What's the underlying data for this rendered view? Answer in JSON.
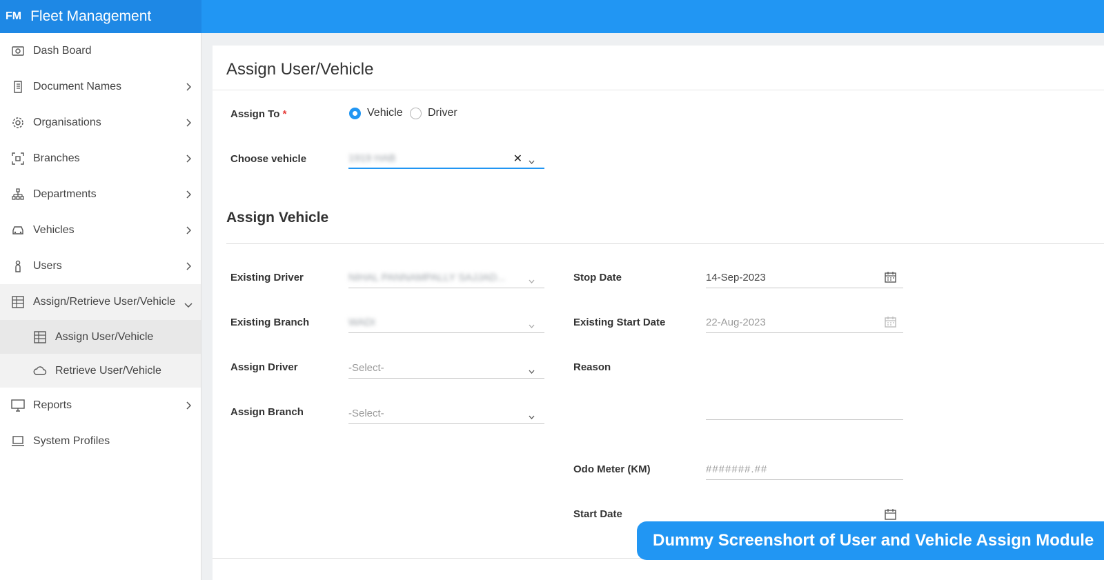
{
  "brand": {
    "abbr": "FM",
    "name": "Fleet Management"
  },
  "sidebar": {
    "items": [
      {
        "label": "Dash Board"
      },
      {
        "label": "Document Names"
      },
      {
        "label": "Organisations"
      },
      {
        "label": "Branches"
      },
      {
        "label": "Departments"
      },
      {
        "label": "Vehicles"
      },
      {
        "label": "Users"
      },
      {
        "label": "Assign/Retrieve User/Vehicle"
      },
      {
        "label": "Reports"
      },
      {
        "label": "System Profiles"
      }
    ],
    "sub_items": [
      {
        "label": "Assign User/Vehicle"
      },
      {
        "label": "Retrieve User/Vehicle"
      }
    ]
  },
  "page": {
    "title": "Assign User/Vehicle",
    "assign_to_label": "Assign To",
    "required_mark": "*",
    "radio_vehicle": "Vehicle",
    "radio_driver": "Driver",
    "choose_vehicle_label": "Choose vehicle",
    "choose_vehicle_value": "1919 HAB",
    "section_title": "Assign Vehicle"
  },
  "form": {
    "existing_driver_label": "Existing Driver",
    "existing_driver_value": "NIHAL PANNAMPALLY SAJJAD...",
    "existing_branch_label": "Existing Branch",
    "existing_branch_value": "WADI",
    "assign_driver_label": "Assign Driver",
    "assign_driver_value": "-Select-",
    "assign_branch_label": "Assign Branch",
    "assign_branch_value": "-Select-",
    "stop_date_label": "Stop Date",
    "stop_date_value": "14-Sep-2023",
    "existing_start_date_label": "Existing Start Date",
    "existing_start_date_value": "22-Aug-2023",
    "reason_label": "Reason",
    "odo_label": "Odo Meter (KM)",
    "odo_placeholder": "#######.##",
    "start_date_label": "Start Date"
  },
  "banner": {
    "text": "Dummy  Screenshort of  User and Vehicle Assign Module"
  },
  "colors": {
    "primary": "#2196f3",
    "brand_dark": "#1e88e5",
    "required": "#e53935"
  }
}
